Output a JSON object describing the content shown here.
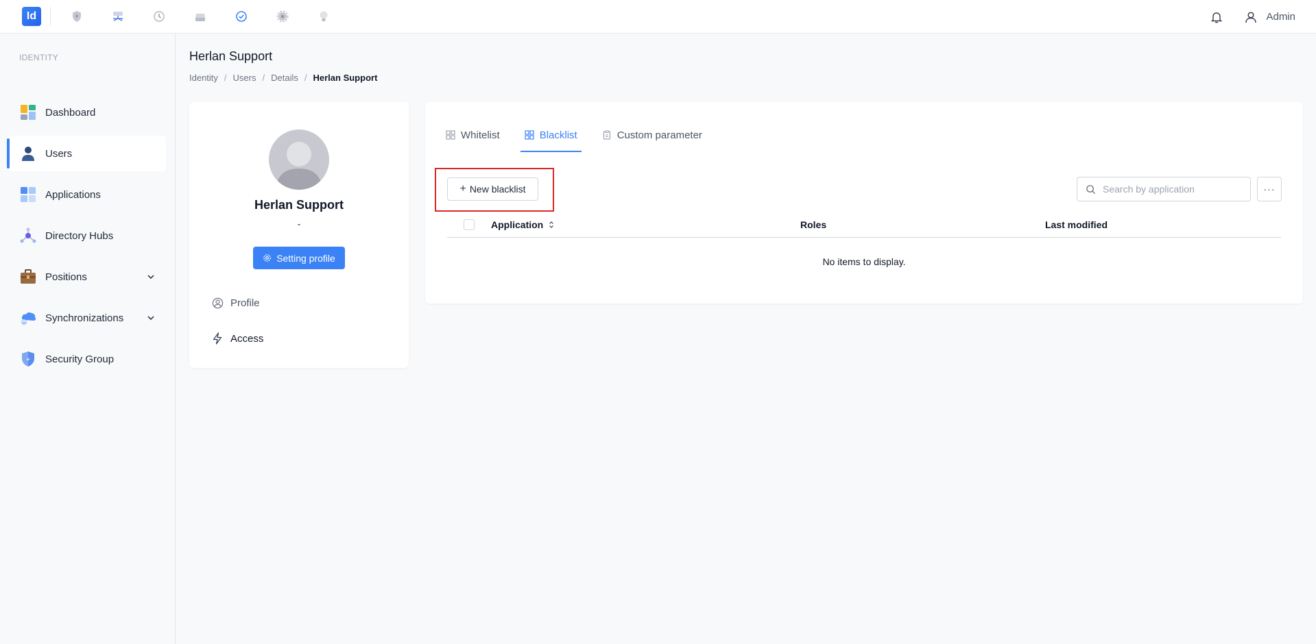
{
  "topbar": {
    "logo_text": "Id",
    "apps": [
      {
        "icon": "shield-icon"
      },
      {
        "icon": "network-icon"
      },
      {
        "icon": "clock-icon"
      },
      {
        "icon": "drive-icon"
      },
      {
        "icon": "check-circle-icon"
      },
      {
        "icon": "gear-icon"
      },
      {
        "icon": "bulb-icon"
      }
    ],
    "user_label": "Admin"
  },
  "sidebar": {
    "section_label": "IDENTITY",
    "items": [
      {
        "label": "Dashboard",
        "icon": "dashboard-icon"
      },
      {
        "label": "Users",
        "icon": "user-icon",
        "active": true
      },
      {
        "label": "Applications",
        "icon": "applications-icon"
      },
      {
        "label": "Directory Hubs",
        "icon": "hub-icon"
      },
      {
        "label": "Positions",
        "icon": "briefcase-icon",
        "expandable": true
      },
      {
        "label": "Synchronizations",
        "icon": "cloud-sync-icon",
        "expandable": true
      },
      {
        "label": "Security Group",
        "icon": "shield-icon"
      }
    ]
  },
  "page": {
    "title": "Herlan Support",
    "breadcrumb": [
      "Identity",
      "Users",
      "Details",
      "Herlan Support"
    ]
  },
  "profile": {
    "name": "Herlan Support",
    "subtitle": "-",
    "setting_button": "Setting profile",
    "links": [
      {
        "label": "Profile",
        "icon": "user-circle-icon"
      },
      {
        "label": "Access",
        "icon": "bolt-icon"
      }
    ]
  },
  "main": {
    "tabs": [
      {
        "label": "Whitelist",
        "icon": "grid-icon"
      },
      {
        "label": "Blacklist",
        "icon": "grid-icon",
        "active": true
      },
      {
        "label": "Custom parameter",
        "icon": "clipboard-icon"
      }
    ],
    "new_button": "New blacklist",
    "search_placeholder": "Search by application",
    "more_button": "···",
    "columns": [
      "Application",
      "Roles",
      "Last modified"
    ],
    "empty_text": "No items to display."
  },
  "colors": {
    "accent": "#3b82f6",
    "highlight": "#dc2626"
  }
}
